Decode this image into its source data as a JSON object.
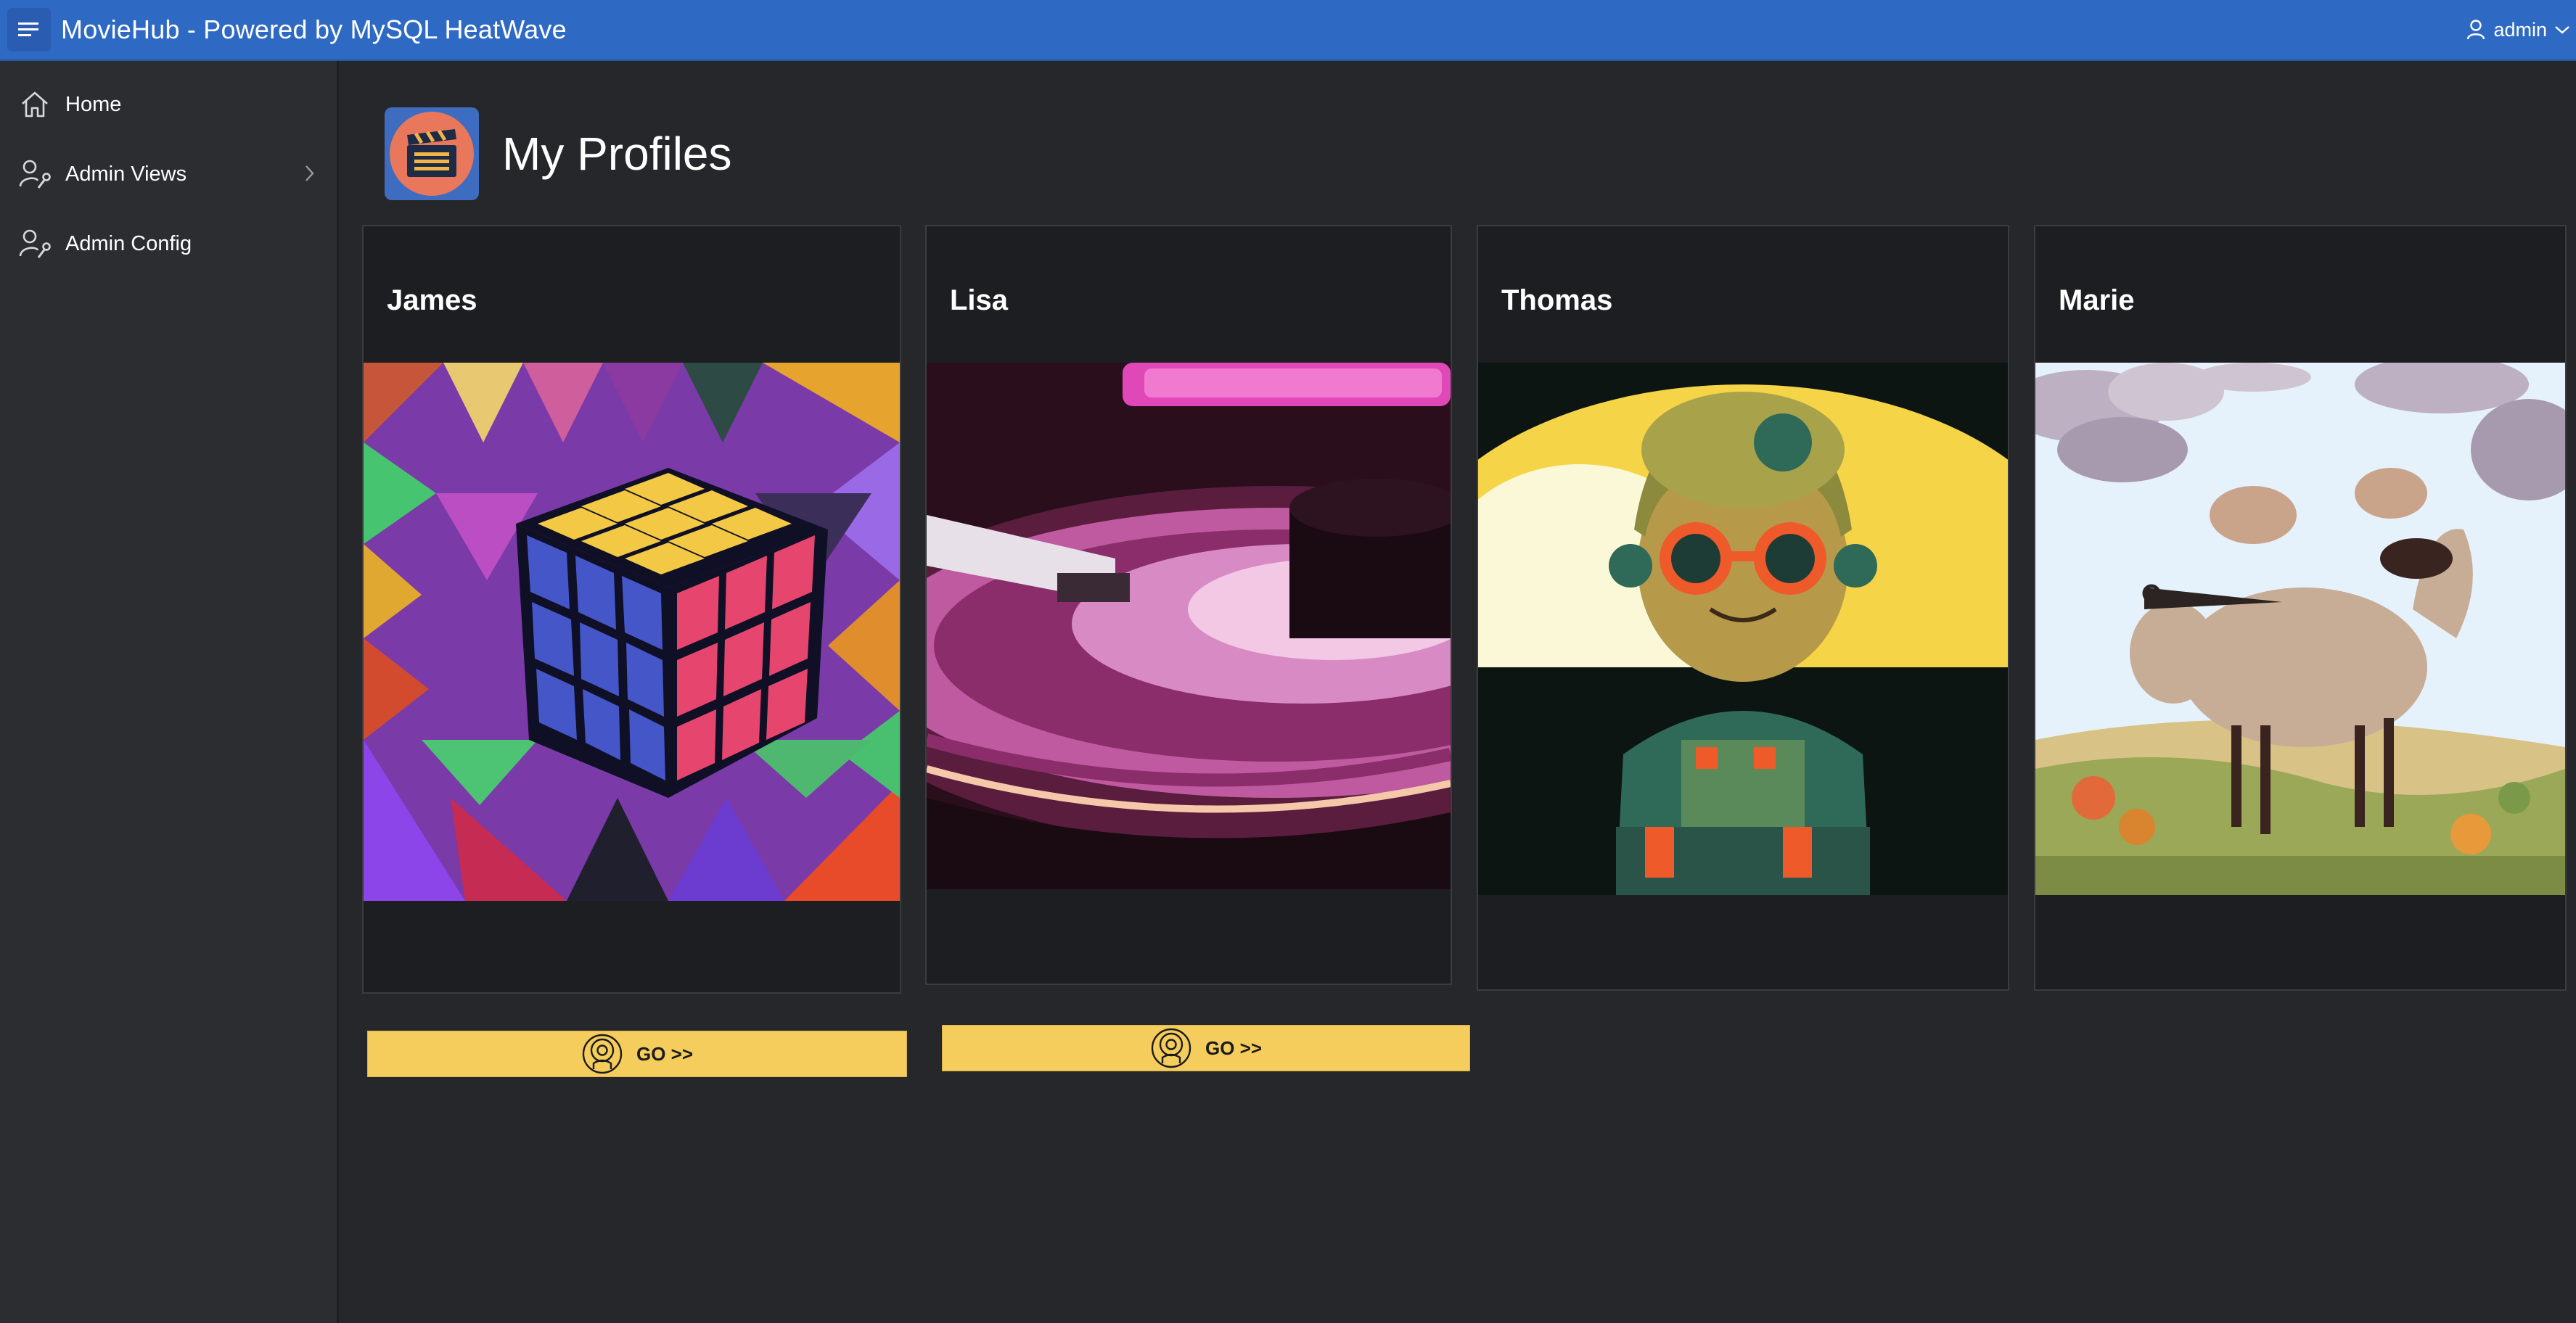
{
  "app": {
    "title": "MovieHub - Powered by MySQL HeatWave"
  },
  "user": {
    "name": "admin"
  },
  "sidebar": {
    "items": [
      {
        "label": "Home",
        "icon": "home-icon"
      },
      {
        "label": "Admin Views",
        "icon": "user-wrench-icon",
        "has_children": true
      },
      {
        "label": "Admin Config",
        "icon": "user-wrench-icon"
      }
    ]
  },
  "page": {
    "title": "My Profiles"
  },
  "profiles": [
    {
      "name": "James",
      "image": "rubiks-cube-illustration"
    },
    {
      "name": "Lisa",
      "image": "vinyl-turntable-illustration"
    },
    {
      "name": "Thomas",
      "image": "cartoon-soldier-illustration"
    },
    {
      "name": "Marie",
      "image": "sheep-landscape-illustration"
    }
  ],
  "buttons": [
    {
      "label": "GO >>"
    },
    {
      "label": "GO >>"
    }
  ],
  "colors": {
    "topbar": "#2e6ac3",
    "sidebar": "#2b2d31",
    "background": "#26272a",
    "card": "#1d1e21",
    "go_button": "#f5cd5d"
  }
}
